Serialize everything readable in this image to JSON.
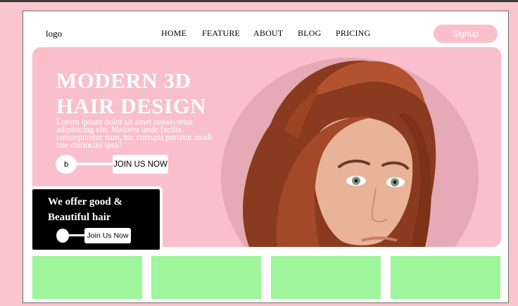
{
  "header": {
    "logo": "logo",
    "nav": [
      "HOME",
      "FEATURE",
      "ABOUT",
      "BLOG",
      "PRICING"
    ],
    "signup_label": "Signup"
  },
  "hero": {
    "title_line1": "MODERN 3D",
    "title_line2": "HAIR DESIGN",
    "body": "Lorem ipsum dolor sit amet consectetur, adipisicing elit. Maiores unde facilis consequuntur nam, hic corrupti pariatur modi iste distinctio ipsa?",
    "join_ball_label": "b",
    "join_label": "JOIN US NOW"
  },
  "offer": {
    "line1": "We offer good &",
    "line2": "Beautiful hair",
    "button_label": "Join Us Now"
  },
  "cards": [
    "",
    "",
    "",
    ""
  ],
  "colors": {
    "background": "#f9c6cd",
    "hero": "#f9bfcc",
    "circle": "#e5aab6",
    "signup": "#f9c0cb",
    "offer_panel": "#000000",
    "card": "#9ef59c"
  },
  "image": "portrait of woman with red hair"
}
